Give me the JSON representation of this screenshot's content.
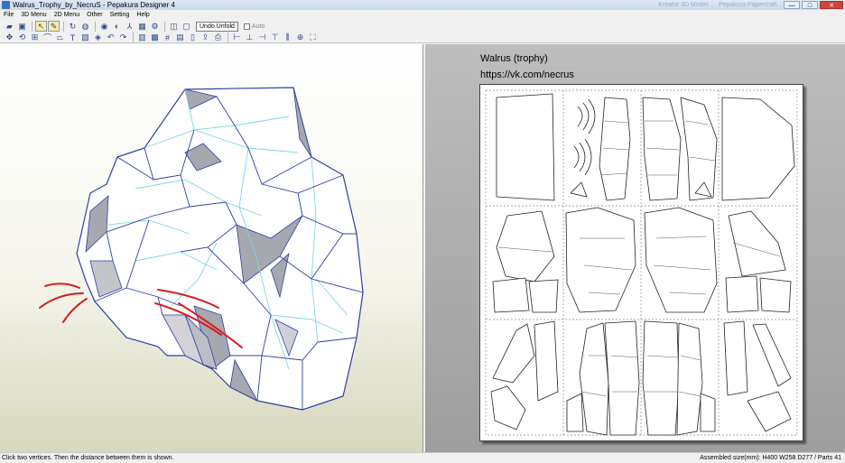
{
  "window": {
    "title": "Walrus_Trophy_by_NecruS - Pepakura Designer 4",
    "ghost_tabs": [
      "Kreator 3D Model...",
      "Pepakura Papercraft..."
    ],
    "minimize": "—",
    "maximize": "□",
    "close": "✕"
  },
  "menu": [
    "File",
    "3D Menu",
    "2D Menu",
    "Other",
    "Setting",
    "Help"
  ],
  "toolbar": {
    "unfold_label": "Undo Unfold",
    "auto_label": "Auto"
  },
  "view2d": {
    "model_title": "Walrus (trophy)",
    "url": "https://vk.com/necrus"
  },
  "status": {
    "hint": "Click two vertices. Then the distance between them is shown.",
    "info": "Assembled size(mm): H400 W258 D277 / Parts 41"
  },
  "colors": {
    "edge_blue": "#2f3fa5",
    "fold_cyan": "#7fd6e6",
    "whisker_red": "#d42020",
    "face_shadow": "#9c9ca4"
  }
}
